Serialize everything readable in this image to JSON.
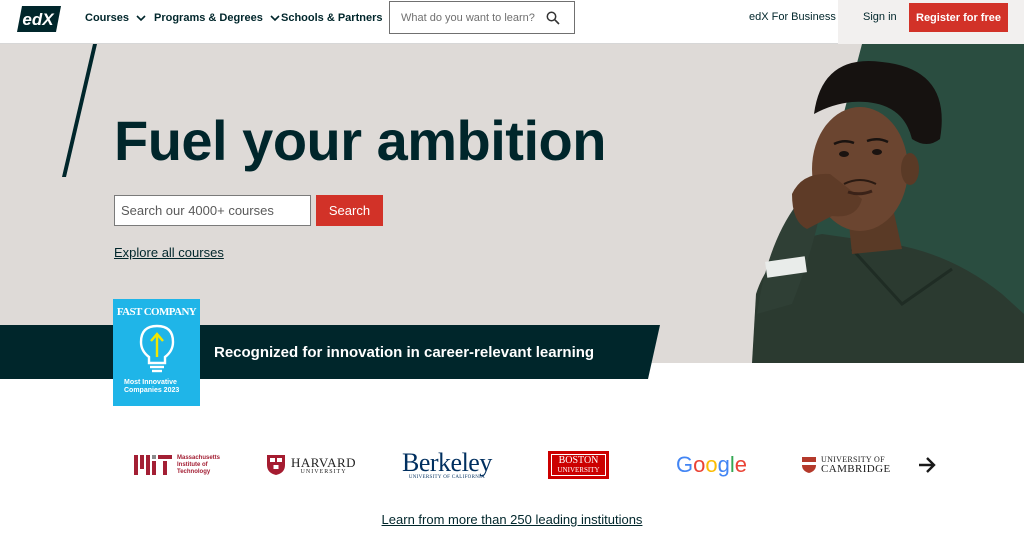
{
  "header": {
    "logo_text": "edX",
    "nav": [
      "Courses",
      "Programs & Degrees",
      "Schools & Partners"
    ],
    "search_placeholder": "What do you want to learn?",
    "business_link": "edX For Business",
    "signin": "Sign in",
    "register": "Register for free"
  },
  "hero": {
    "title": "Fuel your ambition",
    "search_placeholder": "Search our 4000+ courses",
    "search_button": "Search",
    "explore_link": "Explore all courses",
    "recognition": "Recognized for innovation in career-relevant learning",
    "badge": {
      "brand": "FAST COMPANY",
      "line1": "Most Innovative",
      "line2": "Companies 2023"
    }
  },
  "partners": {
    "logos": [
      {
        "name": "MIT",
        "lines": [
          "Massachusetts",
          "Institute of",
          "Technology"
        ]
      },
      {
        "name": "HARVARD",
        "sub": "UNIVERSITY"
      },
      {
        "name": "Berkeley",
        "sub": "UNIVERSITY OF CALIFORNIA"
      },
      {
        "name": "BOSTON",
        "sub": "UNIVERSITY"
      },
      {
        "name": "Google"
      },
      {
        "name": "UNIVERSITY OF",
        "sub": "CAMBRIDGE"
      }
    ],
    "learn_more": "Learn from more than 250 leading institutions"
  },
  "colors": {
    "brand_dark": "#00262b",
    "accent_red": "#d23228",
    "hero_bg": "#dedad7",
    "badge_blue": "#1fb5e8"
  }
}
